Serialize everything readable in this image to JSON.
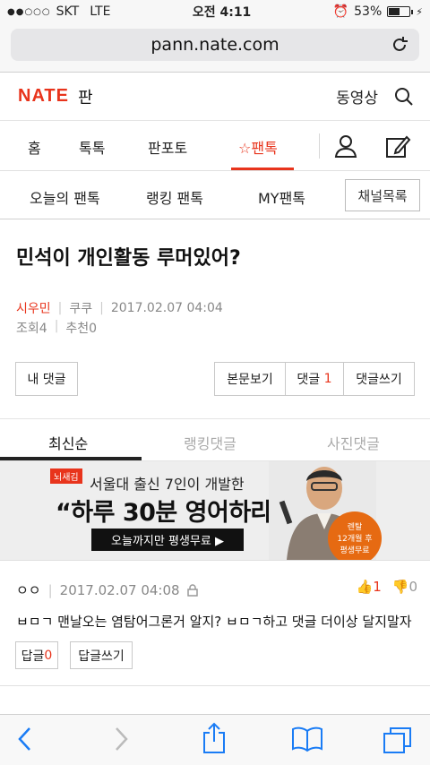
{
  "status_bar": {
    "carrier": "SKT",
    "network": "LTE",
    "time": "오전 4:11",
    "battery": "53%",
    "battery_level": 0.53
  },
  "browser": {
    "url": "pann.nate.com"
  },
  "header": {
    "logo": "NATE",
    "section": "판",
    "video_link": "동영상"
  },
  "main_nav": {
    "tabs": [
      "홈",
      "톡톡",
      "판포토",
      "팬톡"
    ],
    "active_tab": "팬톡"
  },
  "sub_nav": {
    "items": [
      "오늘의 팬톡",
      "랭킹 팬톡",
      "MY팬톡"
    ],
    "channel_button": "채널목록"
  },
  "article": {
    "title": "민석이 개인활동 루머있어?",
    "author": "시우민",
    "nickname": "쿠쿠",
    "date": "2017.02.07 04:04",
    "views_label": "조회",
    "views": "4",
    "recommend_label": "추천",
    "recommend": "0"
  },
  "actions": {
    "my_comments": "내 댓글",
    "view_original": "본문보기",
    "comments_label": "댓글",
    "comments_count": "1",
    "write_comment": "댓글쓰기"
  },
  "comment_tabs": {
    "tabs": [
      "최신순",
      "랭킹댓글",
      "사진댓글"
    ],
    "active": "최신순"
  },
  "ad": {
    "badge": "뇌새김",
    "line1": "서울대 출신 7인이 개발한",
    "line2": "“하루 30분 영어하라”",
    "cta": "오늘까지만 평생무료 ▶",
    "rental_line1": "렌탈",
    "rental_line2": "12개월 후",
    "rental_line3": "평생무료"
  },
  "comment": {
    "author": "ㅇㅇ",
    "date": "2017.02.07 04:08",
    "likes": "1",
    "dislikes": "0",
    "text": "ㅂㅁㄱ 맨날오는 염탐어그론거 알지? ㅂㅁㄱ하고 댓글 더이상 달지말자",
    "reply_label": "답글",
    "reply_count": "0",
    "write_reply": "답글쓰기"
  },
  "colors": {
    "accent": "#e8341c"
  }
}
